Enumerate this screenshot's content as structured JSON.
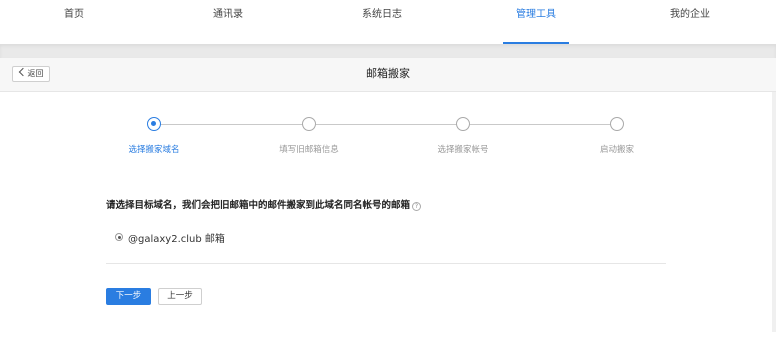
{
  "nav": {
    "items": [
      {
        "label": "首页"
      },
      {
        "label": "通讯录"
      },
      {
        "label": "系统日志"
      },
      {
        "label": "管理工具"
      },
      {
        "label": "我的企业"
      }
    ],
    "active": "管理工具"
  },
  "header": {
    "back_label": "返回",
    "title": "邮箱搬家"
  },
  "steps": [
    {
      "label": "选择搬家域名",
      "active": true
    },
    {
      "label": "填写旧邮箱信息",
      "active": false
    },
    {
      "label": "选择搬家帐号",
      "active": false
    },
    {
      "label": "启动搬家",
      "active": false
    }
  ],
  "form": {
    "question": "请选择目标域名，我们会把旧邮箱中的邮件搬家到此域名同名帐号的邮箱",
    "help_icon_glyph": "?",
    "option_label": "@galaxy2.club 邮箱"
  },
  "buttons": {
    "next_label": "下一步",
    "prev_label": "上一步"
  },
  "colors": {
    "accent": "#2a7de1"
  }
}
